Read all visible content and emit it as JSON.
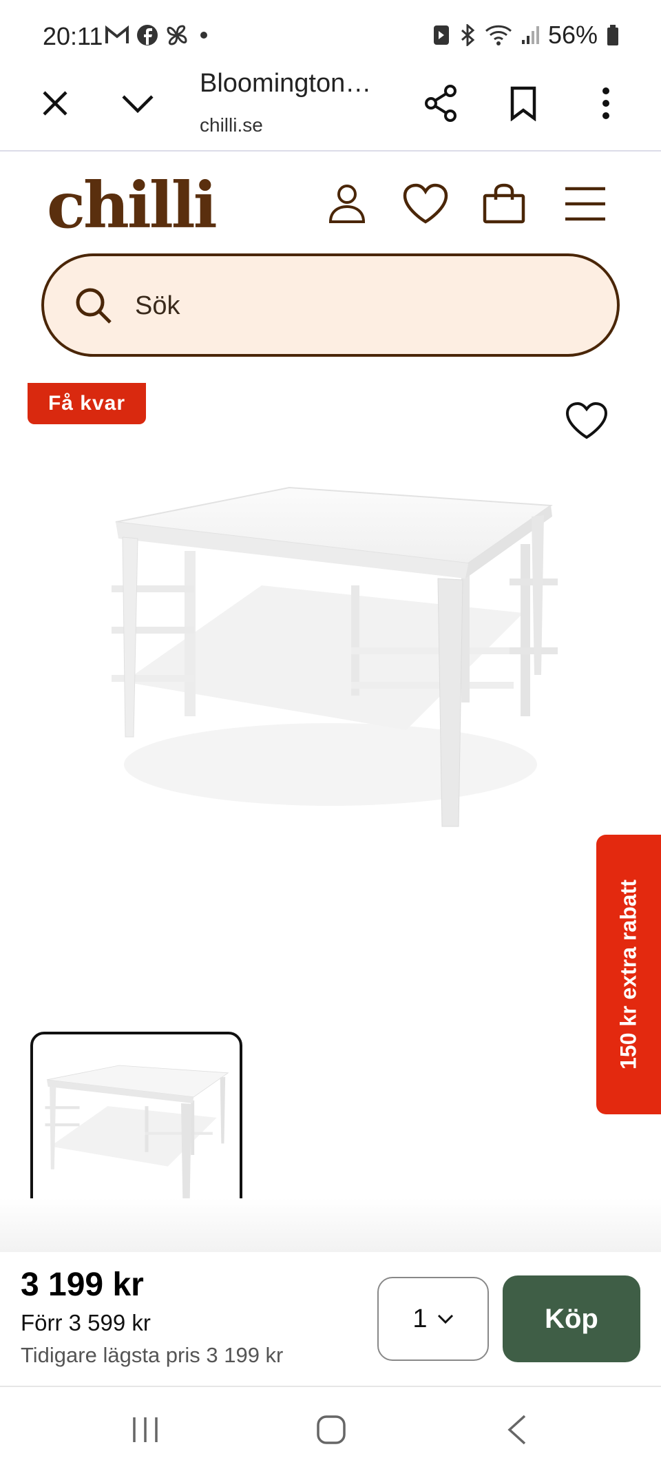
{
  "status_bar": {
    "time": "20:11",
    "battery": "56%",
    "notification_icons": [
      "gmail-icon",
      "facebook-icon",
      "pinwheel-icon",
      "dot-icon"
    ],
    "system_icons": [
      "nfc-icon",
      "bluetooth-icon",
      "wifi-icon",
      "signal-icon",
      "battery-icon"
    ]
  },
  "browser": {
    "page_title": "Bloomington…",
    "domain": "chilli.se",
    "buttons": [
      "close-icon",
      "chevron-down-icon",
      "share-icon",
      "bookmark-icon",
      "more-icon"
    ]
  },
  "site": {
    "logo_text": "chilli",
    "brand_color": "#5a2f0e",
    "header_icons": [
      "account-icon",
      "heart-icon",
      "bag-icon",
      "menu-icon"
    ]
  },
  "search": {
    "placeholder": "Sök"
  },
  "product": {
    "badge": "Få kvar",
    "badge_color": "#d9290f",
    "promo_tab": "150 kr extra rabatt",
    "price": "3 199 kr",
    "was_price": "Förr 3 599 kr",
    "lowest_price": "Tidigare lägsta pris 3 199 kr",
    "quantity": "1",
    "buy_label": "Köp",
    "buy_color": "#3f5e46"
  }
}
